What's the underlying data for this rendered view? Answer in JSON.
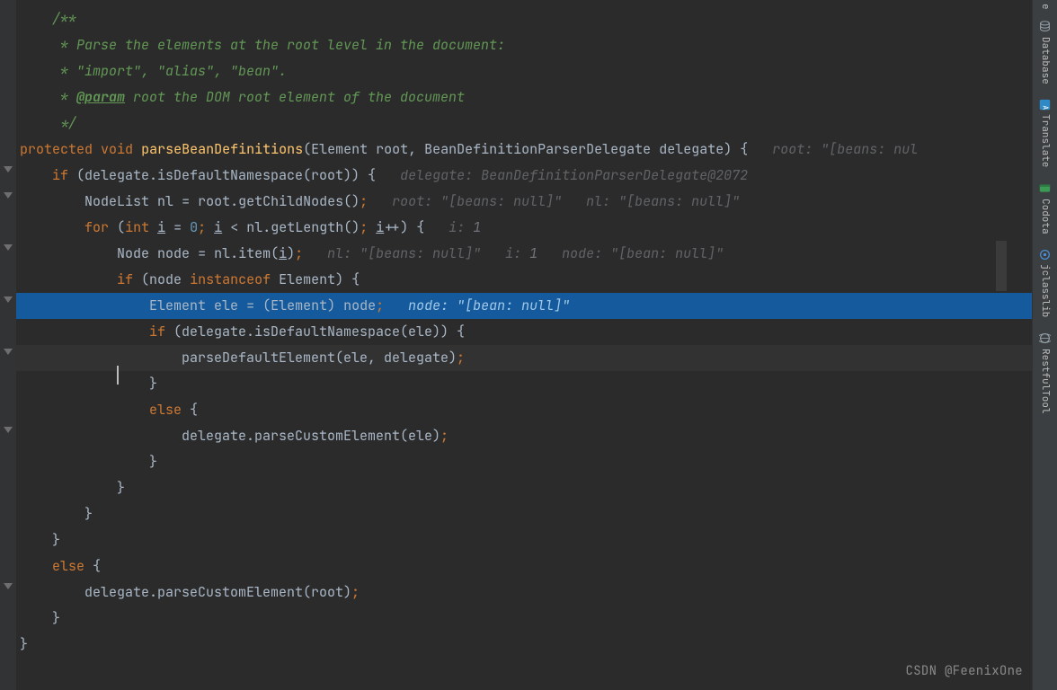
{
  "sidebar": {
    "items": [
      {
        "label": "Database",
        "icon": "database-icon"
      },
      {
        "label": "Translate",
        "icon": "translate-icon"
      },
      {
        "label": "Codota",
        "icon": "codota-icon"
      },
      {
        "label": "jclasslib",
        "icon": "jclasslib-icon"
      },
      {
        "label": "RestfulTool",
        "icon": "restful-icon"
      }
    ],
    "partial_top": "e"
  },
  "code": {
    "c1": "/**",
    "c2": " * Parse the elements at the root level in the document:",
    "c3": " * \"import\", \"alias\", \"bean\".",
    "c4a": " * ",
    "c4tag": "@param",
    "c4b": " root the DOM root element of the document",
    "c5": " */",
    "l6_kw1": "protected",
    "l6_kw2": "void",
    "l6_method": "parseBeanDefinitions",
    "l6_p1t": "Element",
    "l6_p1n": "root",
    "l6_p2t": "BeanDefinitionParserDelegate",
    "l6_p2n": "delegate",
    "l6_inlay": "root: \"[beans: nul",
    "l7_kw": "if",
    "l7_expr": "(delegate.isDefaultNamespace(root)) {",
    "l7_inlay": "delegate: BeanDefinitionParserDelegate@2072",
    "l8_t": "NodeList",
    "l8_v": "nl",
    "l8_expr": "= root.getChildNodes()",
    "l8_inlay": "root: \"[beans: null]\"   nl: \"[beans: null]\"",
    "l9_kw": "for",
    "l9_p1": "(",
    "l9_int": "int",
    "l9_i": "i",
    "l9_eq": " = ",
    "l9_zero": "0",
    "l9_semi1": ";",
    "l9_cond": " i < nl.getLength()",
    "l9_semi2": ";",
    "l9_inc": " i++) {",
    "l9_inlay": "i: 1",
    "l10_t": "Node",
    "l10_v": "node",
    "l10_expr": "= nl.item(i)",
    "l10_inlay": "nl: \"[beans: null]\"   i: 1   node: \"[bean: null]\"",
    "l11_kw": "if",
    "l11_expr1": "(node ",
    "l11_kw2": "instanceof",
    "l11_expr2": " Element) {",
    "l12_t": "Element",
    "l12_v": "ele",
    "l12_expr": "= (Element) node",
    "l12_inlay": "node: \"[bean: null]\"",
    "l13_kw": "if",
    "l13_expr": "(delegate.isDefaultNamespace(ele)) {",
    "l14_expr": "parseDefaultElement(ele, delegate)",
    "l15": "}",
    "l16_kw": "else",
    "l16_b": " {",
    "l17_expr": "delegate.parseCustomElement(ele)",
    "l18": "}",
    "l19": "}",
    "l20": "}",
    "l21": "}",
    "l22_kw": "else",
    "l22_b": " {",
    "l23_expr": "delegate.parseCustomElement(root)",
    "l24": "}",
    "l25": "}"
  },
  "watermark": "CSDN @FeenixOne"
}
